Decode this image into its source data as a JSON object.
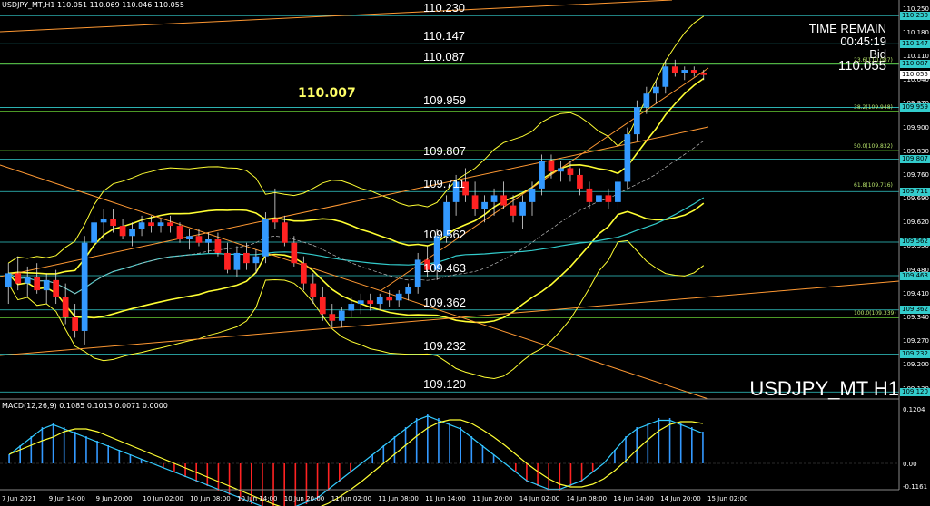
{
  "header": {
    "symbol_line": "USDJPY_MT,H1  110.051 110.069 110.046 110.055",
    "macd_line": "MACD(12,26,9) 0.1085 0.1013 0.0071 0.0000"
  },
  "overlay": {
    "time_remain_label": "TIME REMAIN",
    "time_remain_value": "00:45:19",
    "bid_label": "Bid",
    "bid_value": "110.055",
    "symbol_watermark": "USDJPY_MT H1",
    "bold_level": "110.007"
  },
  "levels": [
    {
      "label": "110.230",
      "price": 110.23
    },
    {
      "label": "110.147",
      "price": 110.147
    },
    {
      "label": "110.087",
      "price": 110.087
    },
    {
      "label": "109.959",
      "price": 109.959
    },
    {
      "label": "109.807",
      "price": 109.807
    },
    {
      "label": "109.711",
      "price": 109.711
    },
    {
      "label": "109.562",
      "price": 109.562
    },
    {
      "label": "109.463",
      "price": 109.463
    },
    {
      "label": "109.362",
      "price": 109.362
    },
    {
      "label": "109.232",
      "price": 109.232
    },
    {
      "label": "109.120",
      "price": 109.12
    }
  ],
  "fib": [
    {
      "label": "23.6(110.087)",
      "price": 110.087
    },
    {
      "label": "38.2(109.948)",
      "price": 109.948
    },
    {
      "label": "50.0(109.832)",
      "price": 109.832
    },
    {
      "label": "61.8(109.716)",
      "price": 109.716
    },
    {
      "label": "100.0(109.339)",
      "price": 109.339
    }
  ],
  "price_axis": [
    "110.250",
    "110.180",
    "110.110",
    "110.040",
    "109.970",
    "109.900",
    "109.830",
    "109.760",
    "109.690",
    "109.620",
    "109.550",
    "109.480",
    "109.410",
    "109.340",
    "109.270",
    "109.200",
    "109.130"
  ],
  "price_tags": [
    {
      "label": "110.230",
      "price": 110.23,
      "color": "#33cccc"
    },
    {
      "label": "110.147",
      "price": 110.147,
      "color": "#33cccc"
    },
    {
      "label": "110.087",
      "price": 110.087,
      "color": "#33cccc"
    },
    {
      "label": "110.055",
      "price": 110.055,
      "color": "#ffffff"
    },
    {
      "label": "109.959",
      "price": 109.959,
      "color": "#33cccc"
    },
    {
      "label": "109.807",
      "price": 109.807,
      "color": "#33cccc"
    },
    {
      "label": "109.711",
      "price": 109.711,
      "color": "#33cccc"
    },
    {
      "label": "109.562",
      "price": 109.562,
      "color": "#33cccc"
    },
    {
      "label": "109.463",
      "price": 109.463,
      "color": "#33cccc"
    },
    {
      "label": "109.362",
      "price": 109.362,
      "color": "#33cccc"
    },
    {
      "label": "109.232",
      "price": 109.232,
      "color": "#33cccc"
    },
    {
      "label": "109.120",
      "price": 109.12,
      "color": "#33cccc"
    }
  ],
  "macd_axis": [
    "0.1204",
    "0.00",
    "-0.1161"
  ],
  "time_axis": [
    "7 Jun 2021",
    "9 Jun 14:00",
    "9 Jun 20:00",
    "10 Jun 02:00",
    "10 Jun 08:00",
    "10 Jun 14:00",
    "10 Jun 20:00",
    "11 Jun 02:00",
    "11 Jun 08:00",
    "11 Jun 14:00",
    "11 Jun 20:00",
    "14 Jun 02:00",
    "14 Jun 08:00",
    "14 Jun 14:00",
    "14 Jun 20:00",
    "15 Jun 02:00"
  ],
  "colors": {
    "bull": "#3399ff",
    "bear": "#ff2222",
    "level": "#33cccc",
    "fib": "#66cc33",
    "band": "#ffff33",
    "trend": "#ff9933",
    "ma": "#33cccc"
  },
  "chart_data": {
    "type": "candlestick",
    "title": "",
    "ylim": [
      109.11,
      110.26
    ],
    "candles": [
      [
        109.43,
        109.5,
        109.38,
        109.47
      ],
      [
        109.47,
        109.52,
        109.42,
        109.44
      ],
      [
        109.44,
        109.49,
        109.4,
        109.46
      ],
      [
        109.46,
        109.5,
        109.41,
        109.42
      ],
      [
        109.42,
        109.47,
        109.38,
        109.45
      ],
      [
        109.45,
        109.48,
        109.38,
        109.4
      ],
      [
        109.4,
        109.44,
        109.32,
        109.34
      ],
      [
        109.34,
        109.38,
        109.28,
        109.3
      ],
      [
        109.3,
        109.58,
        109.26,
        109.56
      ],
      [
        109.56,
        109.64,
        109.52,
        109.62
      ],
      [
        109.62,
        109.66,
        109.57,
        109.63
      ],
      [
        109.63,
        109.66,
        109.59,
        109.61
      ],
      [
        109.61,
        109.63,
        109.57,
        109.58
      ],
      [
        109.58,
        109.62,
        109.55,
        109.6
      ],
      [
        109.6,
        109.64,
        109.58,
        109.62
      ],
      [
        109.62,
        109.64,
        109.59,
        109.61
      ],
      [
        109.61,
        109.63,
        109.59,
        109.62
      ],
      [
        109.62,
        109.64,
        109.59,
        109.61
      ],
      [
        109.61,
        109.62,
        109.56,
        109.57
      ],
      [
        109.57,
        109.6,
        109.54,
        109.58
      ],
      [
        109.58,
        109.6,
        109.55,
        109.56
      ],
      [
        109.56,
        109.59,
        109.53,
        109.57
      ],
      [
        109.57,
        109.59,
        109.52,
        109.53
      ],
      [
        109.53,
        109.56,
        109.47,
        109.48
      ],
      [
        109.48,
        109.55,
        109.46,
        109.53
      ],
      [
        109.53,
        109.56,
        109.48,
        109.5
      ],
      [
        109.5,
        109.54,
        109.47,
        109.52
      ],
      [
        109.52,
        109.65,
        109.5,
        109.63
      ],
      [
        109.63,
        109.72,
        109.6,
        109.62
      ],
      [
        109.62,
        109.64,
        109.55,
        109.56
      ],
      [
        109.56,
        109.58,
        109.49,
        109.5
      ],
      [
        109.5,
        109.52,
        109.42,
        109.44
      ],
      [
        109.44,
        109.47,
        109.38,
        109.4
      ],
      [
        109.4,
        109.43,
        109.33,
        109.35
      ],
      [
        109.35,
        109.38,
        109.31,
        109.33
      ],
      [
        109.33,
        109.37,
        109.31,
        109.36
      ],
      [
        109.36,
        109.4,
        109.34,
        109.38
      ],
      [
        109.38,
        109.41,
        109.35,
        109.39
      ],
      [
        109.39,
        109.41,
        109.36,
        109.38
      ],
      [
        109.38,
        109.41,
        109.36,
        109.4
      ],
      [
        109.4,
        109.42,
        109.37,
        109.39
      ],
      [
        109.39,
        109.42,
        109.37,
        109.41
      ],
      [
        109.41,
        109.44,
        109.39,
        109.43
      ],
      [
        109.43,
        109.53,
        109.41,
        109.51
      ],
      [
        109.51,
        109.55,
        109.46,
        109.48
      ],
      [
        109.48,
        109.6,
        109.45,
        109.58
      ],
      [
        109.58,
        109.7,
        109.56,
        109.68
      ],
      [
        109.68,
        109.76,
        109.64,
        109.74
      ],
      [
        109.74,
        109.78,
        109.68,
        109.7
      ],
      [
        109.7,
        109.74,
        109.64,
        109.66
      ],
      [
        109.66,
        109.7,
        109.62,
        109.68
      ],
      [
        109.68,
        109.72,
        109.64,
        109.7
      ],
      [
        109.7,
        109.74,
        109.66,
        109.67
      ],
      [
        109.67,
        109.7,
        109.62,
        109.64
      ],
      [
        109.64,
        109.7,
        109.6,
        109.68
      ],
      [
        109.68,
        109.74,
        109.64,
        109.72
      ],
      [
        109.72,
        109.82,
        109.7,
        109.8
      ],
      [
        109.8,
        109.82,
        109.75,
        109.77
      ],
      [
        109.77,
        109.8,
        109.74,
        109.78
      ],
      [
        109.78,
        109.8,
        109.74,
        109.76
      ],
      [
        109.76,
        109.78,
        109.7,
        109.72
      ],
      [
        109.72,
        109.74,
        109.66,
        109.68
      ],
      [
        109.68,
        109.72,
        109.66,
        109.7
      ],
      [
        109.7,
        109.72,
        109.66,
        109.68
      ],
      [
        109.68,
        109.76,
        109.66,
        109.74
      ],
      [
        109.74,
        109.9,
        109.72,
        109.88
      ],
      [
        109.88,
        109.98,
        109.86,
        109.96
      ],
      [
        109.96,
        110.02,
        109.94,
        110.0
      ],
      [
        110.0,
        110.04,
        109.97,
        110.02
      ],
      [
        110.02,
        110.1,
        110.0,
        110.08
      ],
      [
        110.08,
        110.1,
        110.05,
        110.06
      ],
      [
        110.06,
        110.08,
        110.04,
        110.07
      ],
      [
        110.07,
        110.08,
        110.05,
        110.06
      ],
      [
        110.06,
        110.07,
        110.04,
        110.055
      ]
    ],
    "macd_hist": [
      0.02,
      0.04,
      0.06,
      0.08,
      0.09,
      0.08,
      0.07,
      0.06,
      0.05,
      0.04,
      0.03,
      0.02,
      0.01,
      0.0,
      -0.01,
      -0.02,
      -0.03,
      -0.04,
      -0.05,
      -0.06,
      -0.07,
      -0.08,
      -0.09,
      -0.1,
      -0.11,
      -0.11,
      -0.1,
      -0.09,
      -0.08,
      -0.06,
      -0.04,
      -0.02,
      0.0,
      0.02,
      0.04,
      0.06,
      0.08,
      0.1,
      0.11,
      0.1,
      0.09,
      0.08,
      0.06,
      0.04,
      0.02,
      0.0,
      -0.02,
      -0.04,
      -0.05,
      -0.06,
      -0.06,
      -0.05,
      -0.04,
      -0.02,
      0.0,
      0.03,
      0.06,
      0.08,
      0.09,
      0.1,
      0.1,
      0.09,
      0.08,
      0.07
    ]
  }
}
